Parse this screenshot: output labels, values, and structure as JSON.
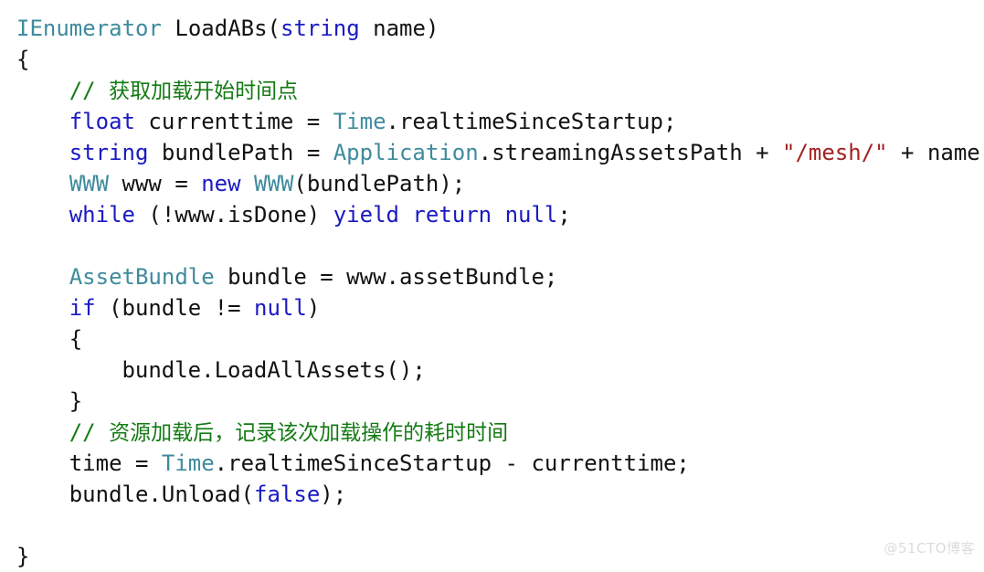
{
  "editor": {
    "language": "csharp",
    "background_color": "#ffffff",
    "colors": {
      "plain": "#121212",
      "keyword": "#1a1ac2",
      "type": "#3f8b9d",
      "string": "#a32121",
      "comment": "#147a14",
      "watermark": "#dcdcdc"
    },
    "lines": [
      {
        "indent": 0,
        "tokens": [
          {
            "kind": "type",
            "text": "IEnumerator"
          },
          {
            "kind": "plain",
            "text": " LoadABs"
          },
          {
            "kind": "punct",
            "text": "("
          },
          {
            "kind": "keyword",
            "text": "string"
          },
          {
            "kind": "plain",
            "text": " name"
          },
          {
            "kind": "punct",
            "text": ")"
          }
        ]
      },
      {
        "indent": 0,
        "tokens": [
          {
            "kind": "punct",
            "text": "{"
          }
        ]
      },
      {
        "indent": 4,
        "tokens": [
          {
            "kind": "comment",
            "text": "// "
          },
          {
            "kind": "comment-cjk",
            "text": "获取加载开始时间点"
          }
        ]
      },
      {
        "indent": 4,
        "tokens": [
          {
            "kind": "keyword",
            "text": "float"
          },
          {
            "kind": "plain",
            "text": " currenttime = "
          },
          {
            "kind": "type",
            "text": "Time"
          },
          {
            "kind": "plain",
            "text": ".realtimeSinceStartup;"
          }
        ]
      },
      {
        "indent": 4,
        "tokens": [
          {
            "kind": "keyword",
            "text": "string"
          },
          {
            "kind": "plain",
            "text": " bundlePath = "
          },
          {
            "kind": "type",
            "text": "Application"
          },
          {
            "kind": "plain",
            "text": ".streamingAssetsPath + "
          },
          {
            "kind": "string",
            "text": "\"/mesh/\""
          },
          {
            "kind": "plain",
            "text": " + name;"
          }
        ]
      },
      {
        "indent": 4,
        "tokens": [
          {
            "kind": "type",
            "text": "WWW"
          },
          {
            "kind": "plain",
            "text": " www = "
          },
          {
            "kind": "keyword",
            "text": "new"
          },
          {
            "kind": "plain",
            "text": " "
          },
          {
            "kind": "type",
            "text": "WWW"
          },
          {
            "kind": "plain",
            "text": "(bundlePath);"
          }
        ]
      },
      {
        "indent": 4,
        "tokens": [
          {
            "kind": "keyword",
            "text": "while"
          },
          {
            "kind": "plain",
            "text": " (!www.isDone) "
          },
          {
            "kind": "keyword",
            "text": "yield"
          },
          {
            "kind": "plain",
            "text": " "
          },
          {
            "kind": "keyword",
            "text": "return"
          },
          {
            "kind": "plain",
            "text": " "
          },
          {
            "kind": "keyword",
            "text": "null"
          },
          {
            "kind": "plain",
            "text": ";"
          }
        ]
      },
      {
        "indent": 0,
        "tokens": []
      },
      {
        "indent": 4,
        "tokens": [
          {
            "kind": "type",
            "text": "AssetBundle"
          },
          {
            "kind": "plain",
            "text": " bundle = www.assetBundle;"
          }
        ]
      },
      {
        "indent": 4,
        "tokens": [
          {
            "kind": "keyword",
            "text": "if"
          },
          {
            "kind": "plain",
            "text": " (bundle != "
          },
          {
            "kind": "keyword",
            "text": "null"
          },
          {
            "kind": "plain",
            "text": ")"
          }
        ]
      },
      {
        "indent": 4,
        "tokens": [
          {
            "kind": "punct",
            "text": "{"
          }
        ]
      },
      {
        "indent": 8,
        "tokens": [
          {
            "kind": "plain",
            "text": "bundle.LoadAllAssets();"
          }
        ]
      },
      {
        "indent": 4,
        "tokens": [
          {
            "kind": "punct",
            "text": "}"
          }
        ]
      },
      {
        "indent": 4,
        "tokens": [
          {
            "kind": "comment",
            "text": "// "
          },
          {
            "kind": "comment-cjk",
            "text": "资源加载后，记录该次加载操作的耗时时间"
          }
        ]
      },
      {
        "indent": 4,
        "tokens": [
          {
            "kind": "plain",
            "text": "time = "
          },
          {
            "kind": "type",
            "text": "Time"
          },
          {
            "kind": "plain",
            "text": ".realtimeSinceStartup - currenttime;"
          }
        ]
      },
      {
        "indent": 4,
        "tokens": [
          {
            "kind": "plain",
            "text": "bundle.Unload("
          },
          {
            "kind": "keyword",
            "text": "false"
          },
          {
            "kind": "plain",
            "text": ");"
          }
        ]
      },
      {
        "indent": 0,
        "tokens": []
      },
      {
        "indent": 0,
        "tokens": [
          {
            "kind": "punct",
            "text": "}"
          }
        ]
      }
    ]
  },
  "watermark": {
    "text": "@51CTO博客"
  }
}
